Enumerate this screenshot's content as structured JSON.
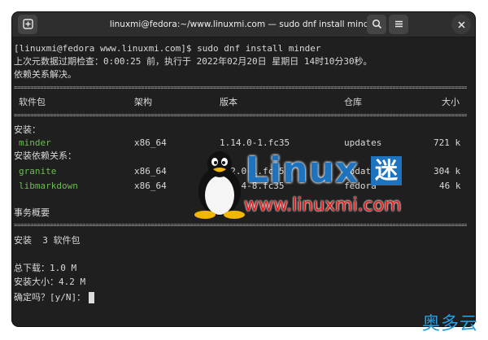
{
  "window": {
    "title": "linuxmi@fedora:~/www.linuxmi.com — sudo dnf install minder",
    "new_tab_icon": "plus-square-icon",
    "search_icon": "search-icon",
    "menu_icon": "hamburger-icon",
    "close_icon": "close-icon"
  },
  "terminal": {
    "prompt": "[linuxmi@fedora www.linuxmi.com]$ sudo dnf install minder",
    "metadata_line": "上次元数据过期检查：0:00:25 前，执行于 2022年02月20日 星期日 14时10分30秒。",
    "resolving": "依赖关系解决。",
    "headers": {
      "package": "软件包",
      "arch": "架构",
      "version": "版本",
      "repo": "仓库",
      "size": "大小"
    },
    "installing_label": "安装：",
    "install_rows": [
      {
        "name": "minder",
        "arch": "x86_64",
        "version": "1.14.0-1.fc35",
        "repo": "updates",
        "size": "721 k"
      }
    ],
    "deps_label": "安装依赖关系：",
    "dep_rows": [
      {
        "name": "granite",
        "arch": "x86_64",
        "version": "6.2.0-1.fc35",
        "repo": "updates",
        "size": "304 k"
      },
      {
        "name": "libmarkdown",
        "arch": "x86_64",
        "version": "2.2.4-8.fc35",
        "repo": "fedora",
        "size": "46 k"
      }
    ],
    "summary_title": "事务概要",
    "summary_install": "安装  3 软件包",
    "total_download": "总下载：1.0 M",
    "installed_size": "安装大小：4.2 M",
    "confirm_prompt": "确定吗？[y/N]："
  },
  "watermark": {
    "brand": "Linux",
    "brand_cn": "迷",
    "url": "www.linuxmi.com",
    "corner": "奥多云"
  },
  "colors": {
    "green": "#6ebb56",
    "brand_blue": "#1e73be",
    "url_red": "#e02020"
  }
}
